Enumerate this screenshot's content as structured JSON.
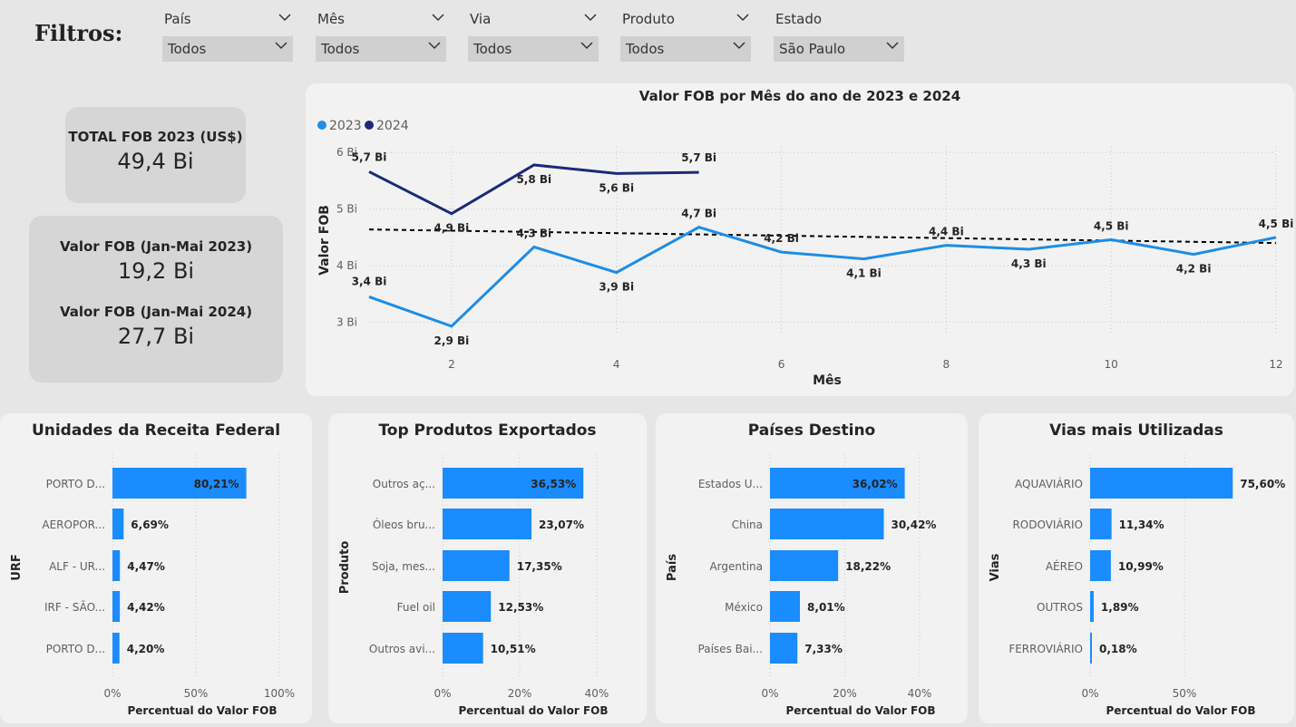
{
  "filters": {
    "title": "Filtros:",
    "items": [
      {
        "label": "País",
        "value": "Todos"
      },
      {
        "label": "Mês",
        "value": "Todos"
      },
      {
        "label": "Via",
        "value": "Todos"
      },
      {
        "label": "Produto",
        "value": "Todos"
      },
      {
        "label": "Estado",
        "value": "São Paulo"
      }
    ]
  },
  "kpi": {
    "total_title": "TOTAL FOB 2023 (US$)",
    "total_value": "49,4 Bi",
    "jan_mai_2023_title": "Valor FOB (Jan-Mai 2023)",
    "jan_mai_2023_value": "19,2 Bi",
    "jan_mai_2024_title": "Valor FOB (Jan-Mai 2024)",
    "jan_mai_2024_value": "27,7 Bi"
  },
  "colors": {
    "series_2023": "#1e8de6",
    "series_2024": "#1a2a7a",
    "bar": "#1a8cff",
    "trend": "#000000"
  },
  "chart_data": [
    {
      "type": "line",
      "title": "Valor FOB por Mês do ano de 2023 e 2024",
      "xlabel": "Mês",
      "ylabel": "Valor FOB",
      "x_ticks": [
        "2",
        "4",
        "6",
        "8",
        "10",
        "12"
      ],
      "y_ticks": [
        "3 Bi",
        "4 Bi",
        "5 Bi",
        "6 Bi"
      ],
      "xlim": [
        1,
        12
      ],
      "ylim": [
        2.8,
        6.1
      ],
      "legend_position": "top-left",
      "grid": true,
      "series": [
        {
          "name": "2023",
          "x": [
            1,
            2,
            3,
            4,
            5,
            6,
            7,
            8,
            9,
            10,
            11,
            12
          ],
          "values": [
            3.45,
            2.93,
            4.33,
            3.88,
            4.68,
            4.24,
            4.12,
            4.36,
            4.29,
            4.46,
            4.2,
            4.5
          ],
          "labels": [
            "3,4 Bi",
            "2,9 Bi",
            "4,3 Bi",
            "3,9 Bi",
            "4,7 Bi",
            "4,2 Bi",
            "4,1 Bi",
            "4,4 Bi",
            "4,3 Bi",
            "4,5 Bi",
            "4,2 Bi",
            "4,5 Bi"
          ]
        },
        {
          "name": "2024",
          "x": [
            1,
            2,
            3,
            4,
            5
          ],
          "values": [
            5.66,
            4.92,
            5.78,
            5.63,
            5.65
          ],
          "labels": [
            "5,7 Bi",
            "4,9 Bi",
            "5,8 Bi",
            "5,6 Bi",
            "5,7 Bi"
          ]
        }
      ],
      "trend_2023": {
        "start": 4.64,
        "end": 4.4
      }
    },
    {
      "type": "bar",
      "title": "Unidades da Receita Federal",
      "ylabel": "URF",
      "xlabel": "Percentual do Valor FOB",
      "categories": [
        "PORTO D...",
        "AEROPOR...",
        "ALF - UR...",
        "IRF - SÃO...",
        "PORTO D..."
      ],
      "values": [
        80.21,
        6.69,
        4.47,
        4.42,
        4.2
      ],
      "labels": [
        "80,21%",
        "6,69%",
        "4,47%",
        "4,42%",
        "4,20%"
      ],
      "x_ticks": [
        "0%",
        "50%",
        "100%"
      ],
      "xlim": [
        0,
        100
      ]
    },
    {
      "type": "bar",
      "title": "Top Produtos Exportados",
      "ylabel": "Produto",
      "xlabel": "Percentual do Valor FOB",
      "categories": [
        "Outros aç...",
        "Óleos bru...",
        "Soja, mes...",
        "Fuel oil",
        "Outros avi..."
      ],
      "values": [
        36.53,
        23.07,
        17.35,
        12.53,
        10.51
      ],
      "labels": [
        "36,53%",
        "23,07%",
        "17,35%",
        "12,53%",
        "10,51%"
      ],
      "x_ticks": [
        "0%",
        "20%",
        "40%"
      ],
      "xlim": [
        0,
        40
      ]
    },
    {
      "type": "bar",
      "title": "Países Destino",
      "ylabel": "País",
      "xlabel": "Percentual do Valor FOB",
      "categories": [
        "Estados U...",
        "China",
        "Argentina",
        "México",
        "Países Bai..."
      ],
      "values": [
        36.02,
        30.42,
        18.22,
        8.01,
        7.33
      ],
      "labels": [
        "36,02%",
        "30,42%",
        "18,22%",
        "8,01%",
        "7,33%"
      ],
      "x_ticks": [
        "0%",
        "20%",
        "40%"
      ],
      "xlim": [
        0,
        40
      ]
    },
    {
      "type": "bar",
      "title": "Vias mais Utilizadas",
      "ylabel": "Vias",
      "xlabel": "Percentual do Valor FOB",
      "categories": [
        "AQUAVIÁRIO",
        "RODOVIÁRIO",
        "AÉREO",
        "OUTROS",
        "FERROVIÁRIO"
      ],
      "values": [
        75.6,
        11.34,
        10.99,
        1.89,
        0.18
      ],
      "labels": [
        "75,60%",
        "11,34%",
        "10,99%",
        "1,89%",
        "0,18%"
      ],
      "x_ticks": [
        "0%",
        "50%"
      ],
      "xlim": [
        0,
        100
      ]
    }
  ]
}
